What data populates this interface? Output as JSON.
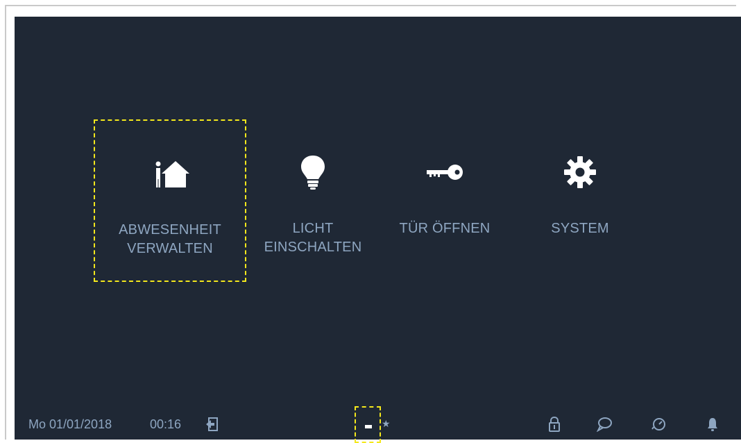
{
  "menu": {
    "items": [
      {
        "label_line1": "ABWESENHEIT",
        "label_line2": "VERWALTEN",
        "icon": "absence-home-icon",
        "selected": true
      },
      {
        "label_line1": "LICHT",
        "label_line2": "EINSCHALTEN",
        "icon": "light-bulb-icon",
        "selected": false
      },
      {
        "label_line1": "TÜR ÖFFNEN",
        "label_line2": "",
        "icon": "door-key-icon",
        "selected": false
      },
      {
        "label_line1": "SYSTEM",
        "label_line2": "",
        "icon": "gear-icon",
        "selected": false
      }
    ]
  },
  "status": {
    "date": "Mo 01/01/2018",
    "time": "00:16",
    "pager_current": "-",
    "pager_star": "★"
  },
  "colors": {
    "background": "#1f2835",
    "label": "#8ea6c1",
    "selection": "#f4e81c",
    "icon": "#ffffff"
  }
}
